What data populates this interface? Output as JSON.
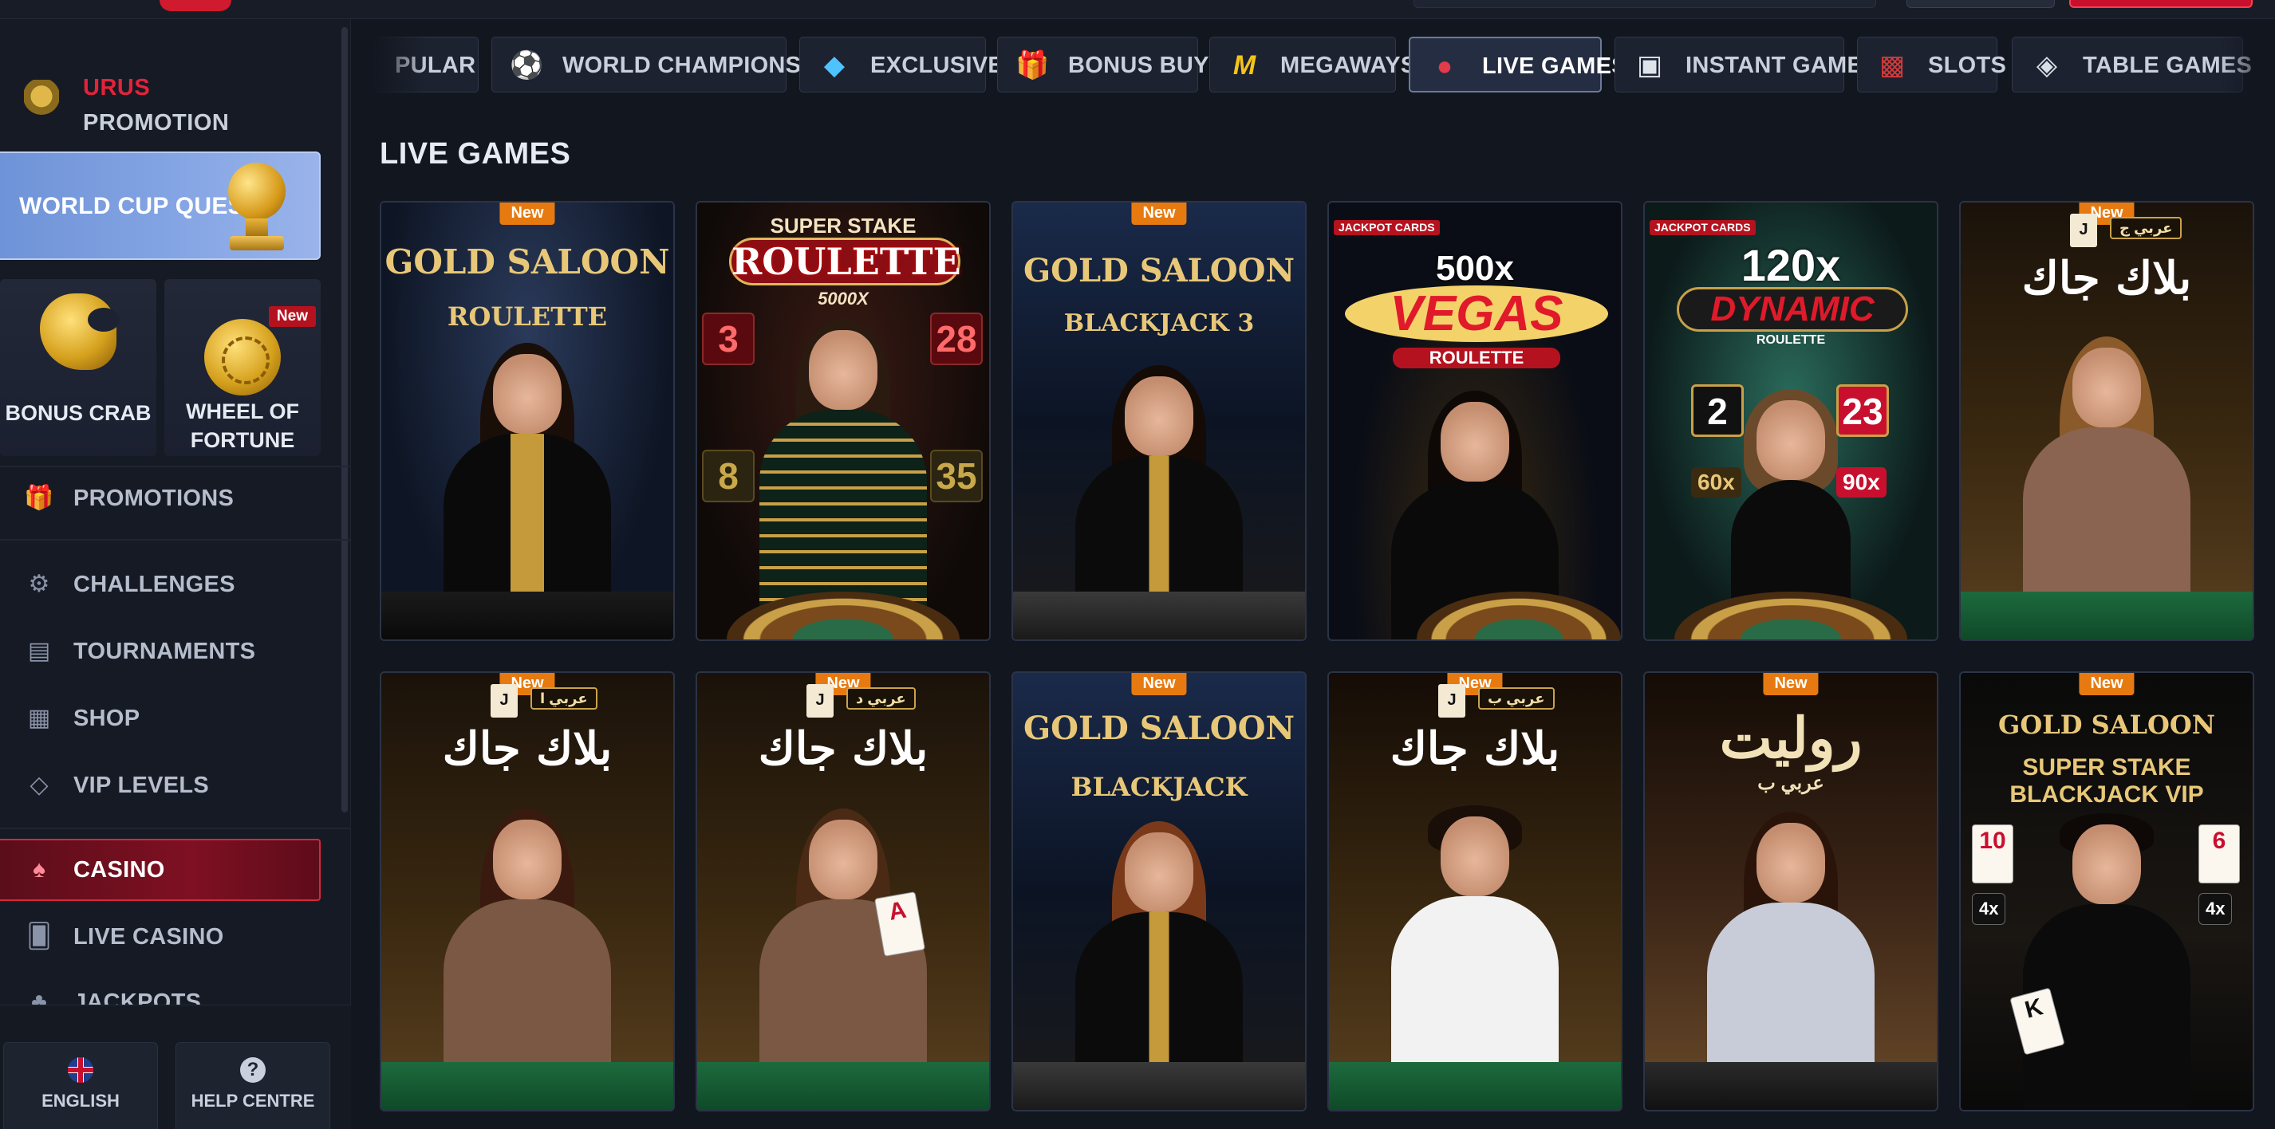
{
  "sidebar": {
    "promo": {
      "line1": "URUS",
      "line2": "PROMOTION"
    },
    "world_cup_quest": "WORLD CUP QUEST",
    "tiles": [
      {
        "label": "BONUS CRAB"
      },
      {
        "label_l1": "WHEEL OF",
        "label_l2": "FORTUNE",
        "badge": "New"
      }
    ],
    "nav": [
      {
        "label": "PROMOTIONS",
        "icon": "gift-icon"
      },
      {
        "label": "CHALLENGES",
        "icon": "gear-icon"
      },
      {
        "label": "TOURNAMENTS",
        "icon": "podium-icon"
      },
      {
        "label": "SHOP",
        "icon": "shop-icon"
      },
      {
        "label": "VIP LEVELS",
        "icon": "diamond-icon"
      },
      {
        "label": "CASINO",
        "icon": "spade-icon",
        "active": true
      },
      {
        "label": "LIVE CASINO",
        "icon": "cards-icon"
      },
      {
        "label": "JACKPOTS",
        "icon": "clover-icon"
      }
    ],
    "bottom": {
      "language": "ENGLISH",
      "help": "HELP CENTRE"
    }
  },
  "categories": [
    {
      "label": "PULAR",
      "icon": "popular-icon"
    },
    {
      "label": "WORLD CHAMPIONSHIP",
      "icon": "soccer-ball-icon"
    },
    {
      "label": "EXCLUSIVE",
      "icon": "diamond-icon"
    },
    {
      "label": "BONUS BUYS",
      "icon": "gift-box-icon"
    },
    {
      "label": "MEGAWAYS",
      "icon": "megaways-m-icon"
    },
    {
      "label": "LIVE GAMES",
      "icon": "live-chips-icon",
      "selected": true
    },
    {
      "label": "INSTANT GAMES",
      "icon": "gamepad-icon"
    },
    {
      "label": "SLOTS",
      "icon": "slot-machine-icon"
    },
    {
      "label": "TABLE GAMES",
      "icon": "table-chips-icon"
    }
  ],
  "section_title": "LIVE GAMES",
  "games": [
    {
      "new": "New",
      "t1": "GOLD SALOON",
      "t2": "ROULETTE"
    },
    {
      "t0": "SUPER STAKE",
      "t1": "ROULETTE",
      "t2": "5000X",
      "nums": [
        "3",
        "28",
        "8",
        "35"
      ]
    },
    {
      "new": "New",
      "t1": "GOLD SALOON",
      "t2": "BLACKJACK 3"
    },
    {
      "jackpot": "JACKPOT CARDS",
      "t1": "500x",
      "t2": "VEGAS",
      "t3": "ROULETTE"
    },
    {
      "jackpot": "JACKPOT CARDS",
      "t1": "120x",
      "t2": "DYNAMIC",
      "t3": "ROULETTE",
      "nums": [
        "2",
        "23"
      ],
      "mults": [
        "60x",
        "90x"
      ]
    },
    {
      "new": "New",
      "card": "J",
      "badge": "عربي ج",
      "t1": "بلاك جاك"
    },
    {
      "new": "New",
      "card": "J",
      "badge": "عربي ا",
      "t1": "بلاك جاك"
    },
    {
      "new": "New",
      "card": "J",
      "badge": "عربي د",
      "t1": "بلاك جاك"
    },
    {
      "new": "New",
      "t1": "GOLD SALOON",
      "t2": "BLACKJACK"
    },
    {
      "new": "New",
      "card": "J",
      "badge": "عربي ب",
      "t1": "بلاك جاك"
    },
    {
      "new": "New",
      "t1": "روليت",
      "t2": "عربي ب"
    },
    {
      "new": "New",
      "t1": "GOLD SALOON",
      "t2": "SUPER STAKE",
      "t3": "BLACKJACK VIP",
      "cards": [
        "10",
        "6"
      ],
      "mults": [
        "4x",
        "4x"
      ]
    }
  ],
  "colors": {
    "accent_red": "#d4283f",
    "wcq_blue": "#7c9edf",
    "new_orange": "#e67a10",
    "gold": "#d9b25a"
  }
}
